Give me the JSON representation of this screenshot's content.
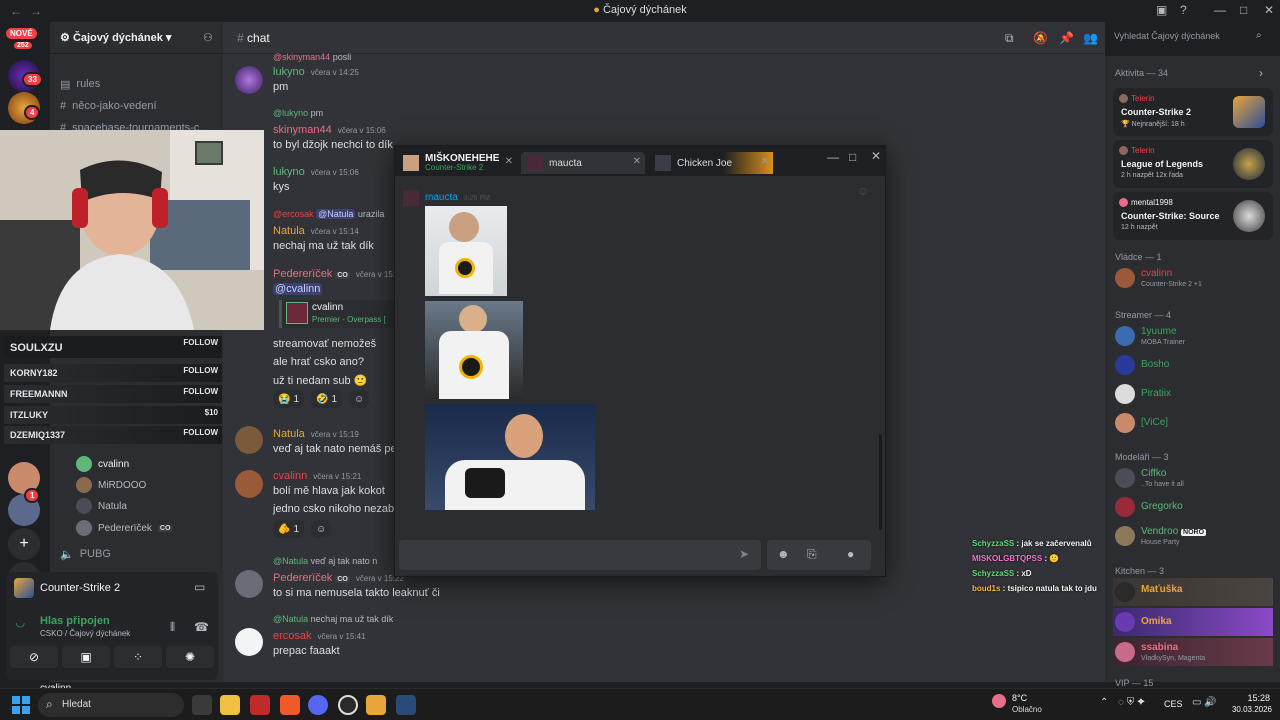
{
  "titlebar": {
    "back": "←",
    "forward": "→",
    "title": "Čajový dýchánek"
  },
  "rail": {
    "new_badge": "NOVÉ",
    "count_badge": "252",
    "badges": [
      "33",
      "4",
      "1"
    ]
  },
  "server": {
    "name": "Čajový dýchánek"
  },
  "channels": [
    {
      "label": "rules"
    },
    {
      "label": "něco-jako-vedení"
    },
    {
      "label": "spacebase-tournaments-c..."
    }
  ],
  "voice_users": [
    {
      "name": "cvalinn"
    },
    {
      "name": "MiRDOOO"
    },
    {
      "name": "Natula"
    },
    {
      "name": "Pedererïček",
      "tag": "CO"
    }
  ],
  "voice_channel": "PUBG",
  "game_activity": "Counter-Strike 2",
  "voice_status": {
    "label": "Hlas připojen",
    "sub": "CSKO / Čajový dýchánek"
  },
  "panel_user": "cvalinn",
  "chat": {
    "channel": "chat",
    "messages": [
      {
        "reply": "posli",
        "reply_user": "@skinyman44",
        "name": "lukyno",
        "color": "#5fb77a",
        "time": "včera v 14:25",
        "lines": [
          "pm"
        ]
      },
      {
        "reply": "pm",
        "reply_user": "@lukyno",
        "name": "skinyman44",
        "color": "#e86d8a",
        "time": "včera v 15:06",
        "lines": [
          "to byl džojk nechci to dík"
        ]
      },
      {
        "name": "lukyno",
        "color": "#5fb77a",
        "time": "včera v 15:06",
        "lines": [
          "kys"
        ]
      },
      {
        "reply": "urazila",
        "reply_user": "@ercosak",
        "reply_mention": "@Natula",
        "name": "Natula",
        "color": "#e8a63b",
        "time": "včera v 15:14",
        "lines": [
          "nechaj ma už tak dík"
        ]
      },
      {
        "name": "Pedererïček",
        "tag": "CO",
        "color": "#e86d8a",
        "time": "včera v 15:17",
        "mention": "@cvalinn",
        "embed_name": "cvalinn",
        "embed_sub": "Premier - Overpass [",
        "lines": [
          "streamovať nemožeš",
          "ale hrať csko ano?",
          "už ti nedam sub 🙂"
        ],
        "reactions": [
          {
            "emoji": "😭",
            "count": "1"
          },
          {
            "emoji": "🤣",
            "count": "1"
          }
        ]
      },
      {
        "name": "Natula",
        "color": "#e8a63b",
        "time": "včera v 15:19",
        "lines": [
          "veď aj tak nato nemáš peni"
        ]
      },
      {
        "name": "cvalinn",
        "color": "#f23f43",
        "time": "včera v 15:21",
        "lines": [
          "bolí mě hlava jak kokot",
          "jedno csko nikoho nezabije"
        ],
        "reactions": [
          {
            "emoji": "🫵",
            "count": "1"
          }
        ]
      },
      {
        "reply": "veď aj tak nato n",
        "reply_user": "@Natula",
        "name": "Pedererïček",
        "tag": "CO",
        "color": "#e86d8a",
        "time": "včera v 15:22",
        "lines": [
          "to si ma nemusela takto leaknuť či"
        ]
      },
      {
        "reply": "nechaj ma už tak dík",
        "reply_user": "@Natula",
        "name": "ercosak",
        "color": "#f23f43",
        "time": "včera v 15:41",
        "lines": [
          "prepac faaakt"
        ]
      }
    ]
  },
  "popout": {
    "tabs": [
      {
        "name": "MIŠKONEHEHE",
        "sub": "Counter-Strike 2"
      },
      {
        "name": "maucta"
      },
      {
        "name": "Chicken Joe"
      }
    ],
    "message": {
      "name": "maucta",
      "time": "3:26 PM"
    }
  },
  "search": {
    "placeholder": "Vyhledat Čajový dýchánek"
  },
  "members": {
    "activity_header": "Aktivita — 34",
    "activities": [
      {
        "user": "Telerin",
        "game": "Counter-Strike 2",
        "status": "🏆 Nejnranější: 18 h"
      },
      {
        "user": "Telerin",
        "game": "League of Legends",
        "status": "2 h nazpět   12x řada"
      },
      {
        "user": "mental1998",
        "game": "Counter-Strike: Source",
        "status": "12 h nazpět"
      }
    ],
    "groups": [
      {
        "header": "Vládce — 1",
        "items": [
          {
            "name": "cvalinn",
            "color": "#f23f43",
            "sub": "Counter-Strike 2 +1"
          }
        ]
      },
      {
        "header": "Streamer — 4",
        "items": [
          {
            "name": "1yuume",
            "color": "#3ba55c",
            "sub": "MOBA Trainer"
          },
          {
            "name": "Bosho",
            "color": "#3ba55c",
            "sub": ""
          },
          {
            "name": "Piratiix",
            "color": "#3ba55c",
            "sub": ""
          },
          {
            "name": "[ViCe]",
            "color": "#3ba55c",
            "sub": ""
          }
        ]
      },
      {
        "header": "Modeláři — 3",
        "items": [
          {
            "name": "Ciffko",
            "color": "#5fb77a",
            "sub": "..To have it all"
          },
          {
            "name": "Gregorko",
            "color": "#5fb77a",
            "sub": ""
          },
          {
            "name": "Vendroo",
            "color": "#5fb77a",
            "sub": "House Party",
            "tag": "NORO"
          }
        ]
      },
      {
        "header": "Kitchen — 3",
        "items": [
          {
            "name": "Maťuška",
            "color": "#e8a63b",
            "sub": ""
          },
          {
            "name": "Omika",
            "color": "#e8a63b",
            "sub": ""
          },
          {
            "name": "ssabina",
            "color": "#e86d8a",
            "sub": "VladkySyn, Magenta"
          }
        ]
      }
    ],
    "vip_header": "VIP — 15"
  },
  "stream": {
    "follows": [
      {
        "name": "SOULXZU",
        "action": "FOLLOW"
      },
      {
        "name": "KORNY182",
        "action": "FOLLOW"
      },
      {
        "name": "FREEMANNN",
        "action": "FOLLOW"
      },
      {
        "name": "ITZLUKY",
        "action": "$10"
      },
      {
        "name": "DZEMIQ1337",
        "action": "FOLLOW"
      }
    ],
    "chat": [
      {
        "user": "SchyzzaSS",
        "text": "jak se začervenalů",
        "color": "#5fdc7a"
      },
      {
        "user": "MISKOLGBTQPSS",
        "text": "🙂",
        "color": "#ff6fd0"
      },
      {
        "user": "SchyzzaSS",
        "text": "xD",
        "color": "#5fdc7a"
      },
      {
        "user": "boud1s",
        "text": "tsipico natula tak to jdu",
        "color": "#ffb347"
      }
    ]
  },
  "taskbar": {
    "search": "Hledat",
    "weather_temp": "8°C",
    "weather_desc": "Oblačno",
    "lang": "CES",
    "time": "15:28",
    "date": "30.03.2026"
  },
  "colors": {
    "accent": "#5865f2",
    "red": "#f23f43",
    "green": "#3ba55c"
  }
}
